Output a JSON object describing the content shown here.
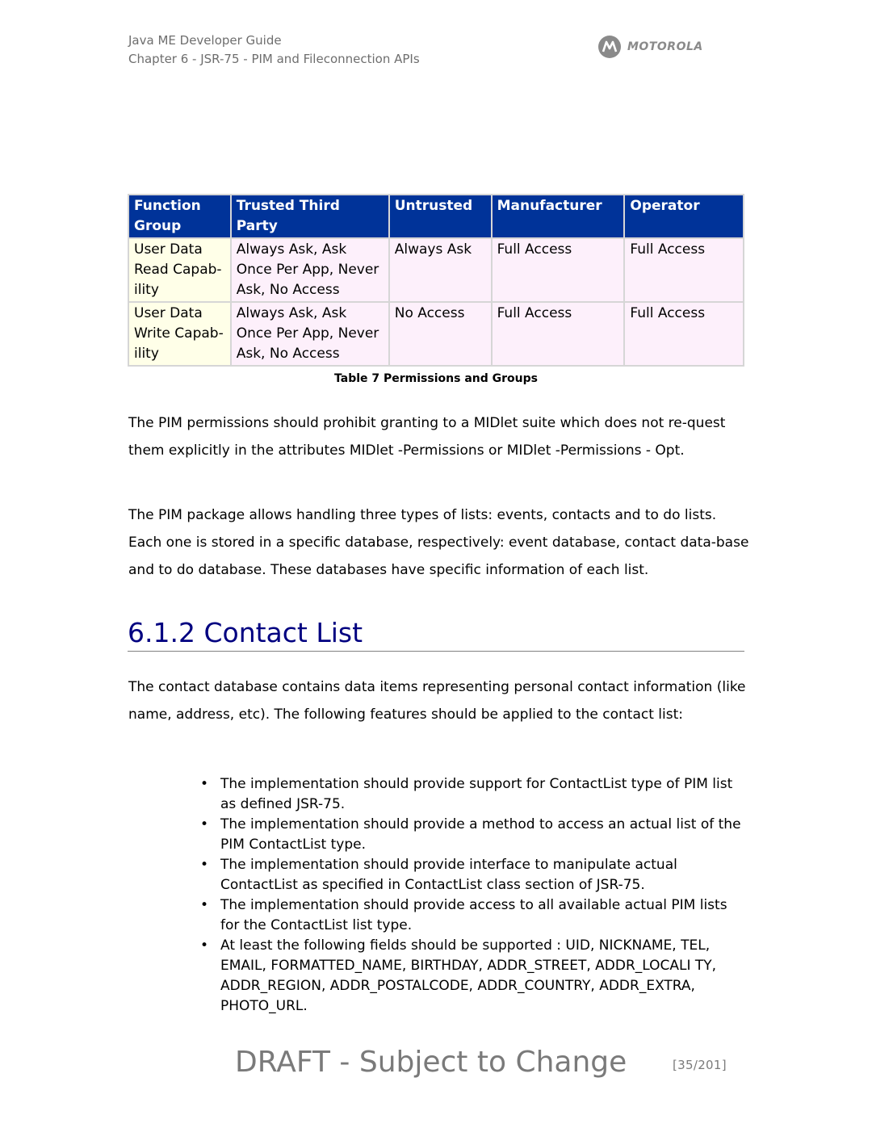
{
  "header": {
    "doc_title": "Java ME Developer Guide",
    "chapter": "Chapter 6 - JSR-75 - PIM and Fileconnection APIs",
    "logo_text": "MOTOROLA",
    "logo_icon": "motorola-batwing-icon"
  },
  "table": {
    "columns": [
      "Function Group",
      "Trusted Third Party",
      "Untrusted",
      "Manufacturer",
      "Operator"
    ],
    "rows": [
      [
        "User Data Read Capab-ility",
        "Always Ask, Ask Once Per App, Never Ask, No Access",
        "Always Ask",
        "Full Access",
        "Full Access"
      ],
      [
        "User Data Write Capab-ility",
        "Always Ask, Ask Once Per App, Never Ask, No Access",
        "No Access",
        "Full Access",
        "Full Access"
      ]
    ],
    "caption": "Table 7 Permissions and Groups",
    "colors": {
      "header_bg": "#003399",
      "group_bg": "#ffffe8",
      "cell_bg": "#fdf0fb"
    }
  },
  "paragraphs": {
    "p1": "The PIM permissions should prohibit granting to a MIDlet suite which does not re-quest them explicitly in the attributes MIDlet -Permissions or MIDlet -Permissions - Opt.",
    "p2": "The PIM package allows handling three types of lists: events, contacts and to do lists. Each one is stored in a specific database, respectively: event database, contact data-base and to do database. These databases have specific information of each list."
  },
  "section": {
    "heading": "6.1.2 Contact List",
    "intro": "The contact database contains data items representing personal contact information (like name, address, etc). The following features should be applied to the contact list:",
    "bullets": [
      "The implementation should provide support for ContactList type of PIM list as defined JSR-75.",
      "The implementation should provide a method to access an actual list of the PIM ContactList type.",
      "The implementation should provide interface to manipulate actual ContactList as specified in ContactList class section of JSR-75.",
      "The implementation should provide access to all available actual PIM lists for the ContactList list type.",
      "At least the following fields should be supported : UID, NICKNAME, TEL, EMAIL, FORMATTED_NAME, BIRTHDAY, ADDR_STREET, ADDR_LOCALI TY, ADDR_REGION, ADDR_POSTALCODE, ADDR_COUNTRY, ADDR_EXTRA, PHOTO_URL."
    ],
    "bullet_glyph": "•"
  },
  "footer": {
    "draft_notice": "DRAFT - Subject to Change",
    "page_number": "[35/201]"
  }
}
